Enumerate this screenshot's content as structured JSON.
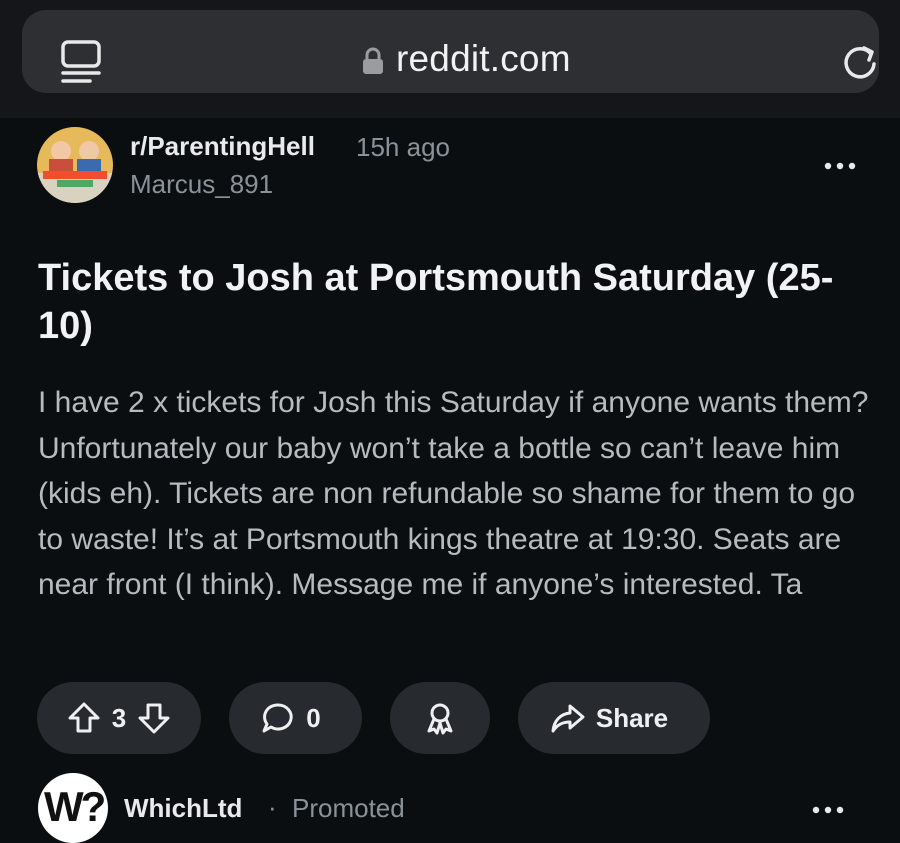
{
  "browser": {
    "url": "reddit.com",
    "icons": {
      "reader": "reader-mode-icon",
      "lock": "lock-icon",
      "reload": "reload-icon"
    }
  },
  "post": {
    "subreddit": "r/ParentingHell",
    "time_ago": "15h ago",
    "author": "Marcus_891",
    "title": "Tickets to Josh at Portsmouth Saturday (25-10)",
    "body": "I have 2 x tickets for Josh this Saturday if anyone wants them? Unfortunately our baby won’t take a bottle so can’t leave him (kids eh). Tickets are non refundable so shame for them to go to waste! It’s at Portsmouth kings theatre at 19:30. Seats are near front (I think). Message me if anyone’s interested. Ta",
    "votes": "3",
    "comments": "0",
    "share_label": "Share"
  },
  "promoted": {
    "logo_text": "W?",
    "name": "WhichLtd",
    "separator": "·",
    "label": "Promoted"
  },
  "colors": {
    "background": "#0b0e11",
    "pill": "#272a2e",
    "muted_text": "#8a9299"
  }
}
